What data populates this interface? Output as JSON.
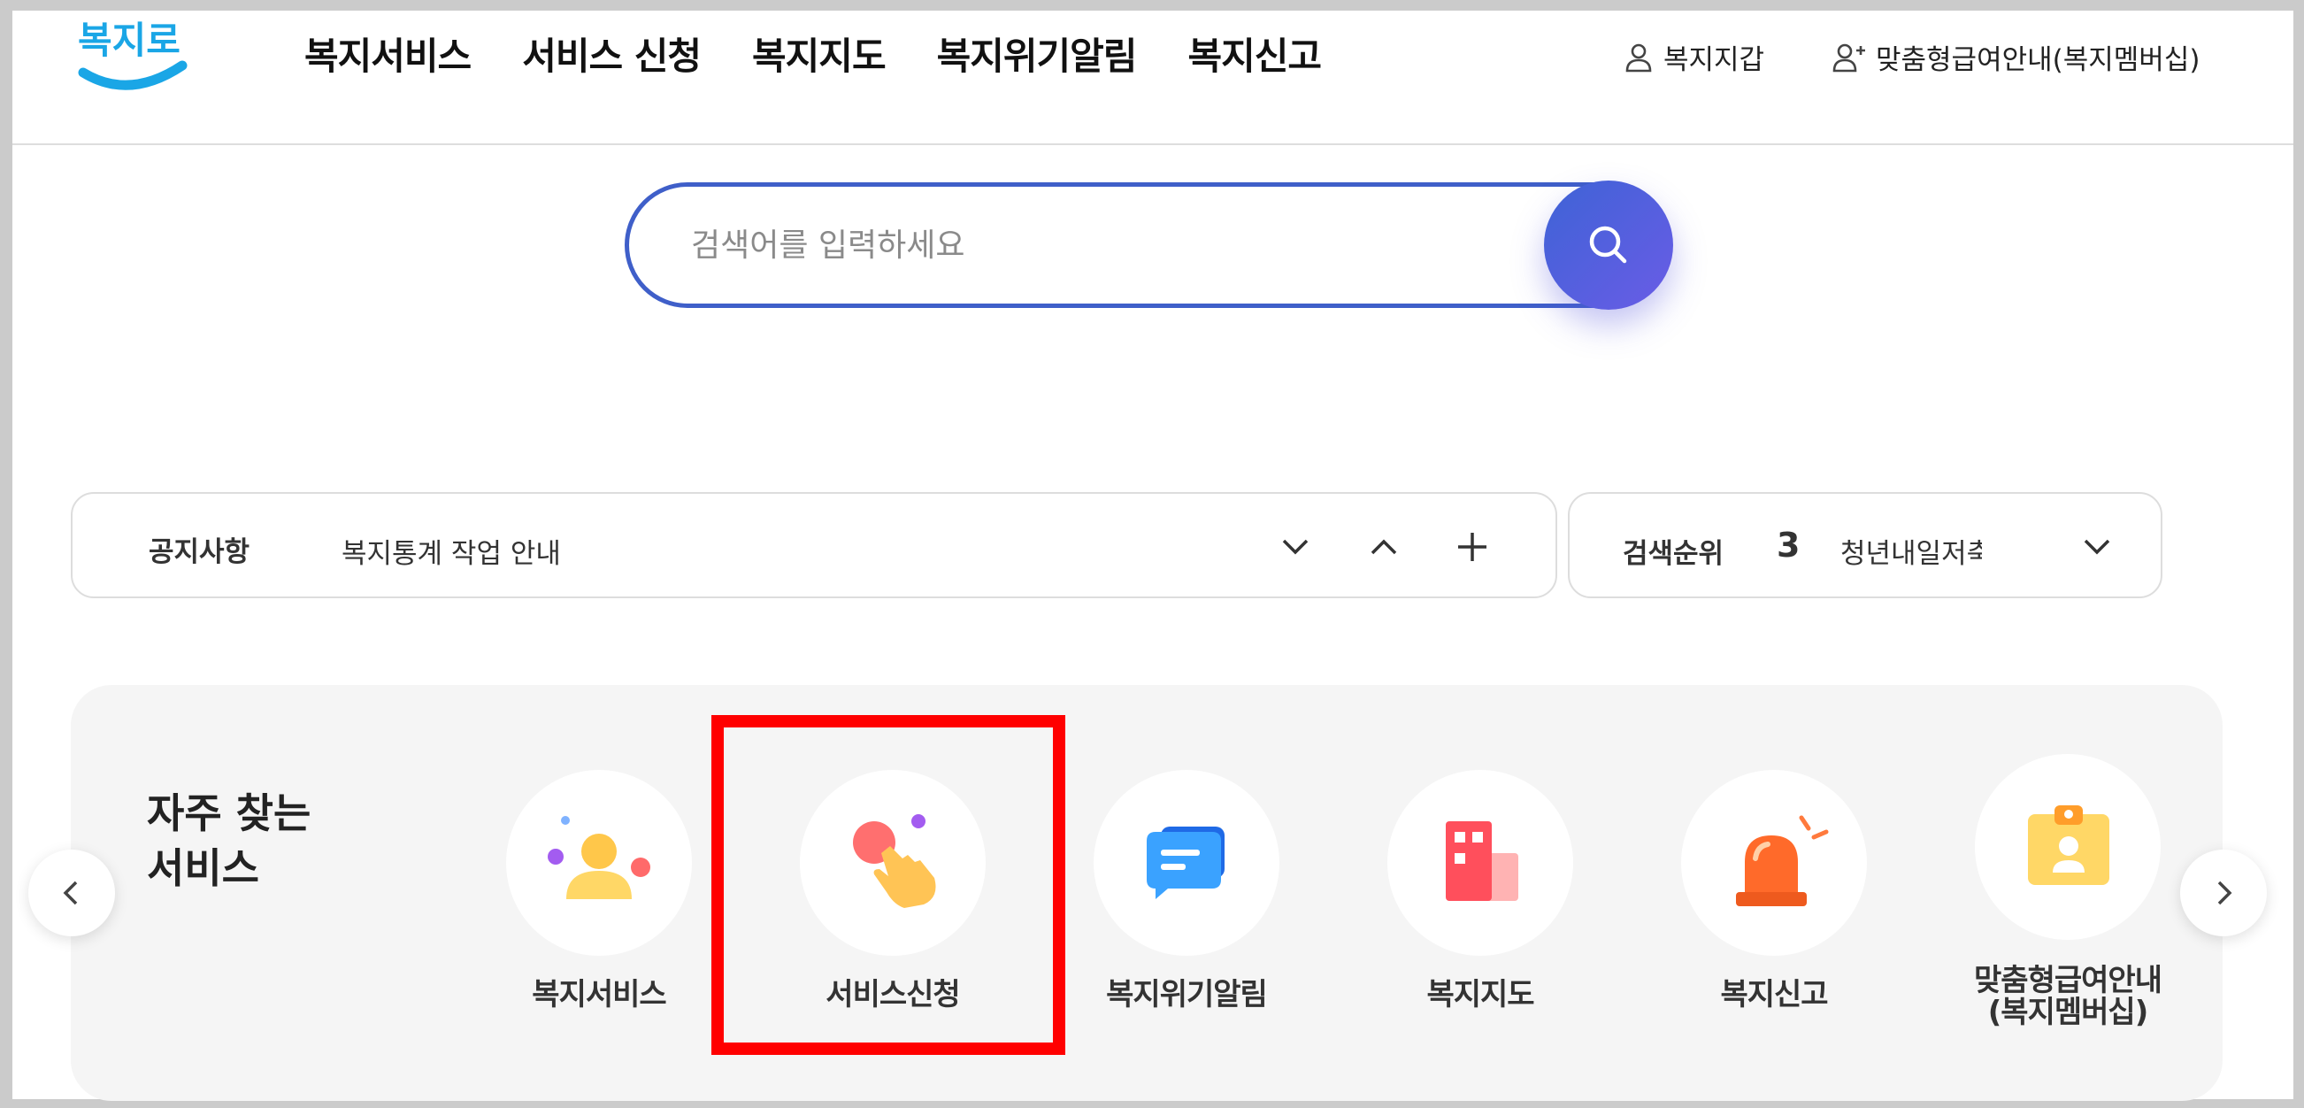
{
  "header": {
    "logo_text": "복지로",
    "nav": [
      "복지서비스",
      "서비스 신청",
      "복지지도",
      "복지위기알림",
      "복지신고"
    ],
    "utility": {
      "wallet": "복지지갑",
      "membership": "맞춤형급여안내(복지멤버십)"
    }
  },
  "search": {
    "placeholder": "검색어를 입력하세요",
    "value": "",
    "icon": "search-icon"
  },
  "notice": {
    "title": "공지사항",
    "text": "복지통계 작업 안내",
    "controls": [
      "chevron-down-icon",
      "chevron-up-icon",
      "plus-icon"
    ]
  },
  "search_rank": {
    "title": "검색순위",
    "rank": "3",
    "term": "청년내일저축"
  },
  "frequent": {
    "title": "자주 찾는 서비스",
    "items": [
      {
        "label": "복지서비스",
        "icon": "people-icon"
      },
      {
        "label": "서비스신청",
        "icon": "hand-tap-icon"
      },
      {
        "label": "복지위기알림",
        "icon": "message-icon"
      },
      {
        "label": "복지지도",
        "icon": "building-icon"
      },
      {
        "label": "복지신고",
        "icon": "siren-icon"
      },
      {
        "label": "맞춤형급여안내\n(복지멤버십)",
        "icon": "id-card-icon"
      }
    ]
  },
  "colors": {
    "accent": "#3f5fc9",
    "highlight": "#ff0000",
    "logo": "#1aa6e6"
  }
}
